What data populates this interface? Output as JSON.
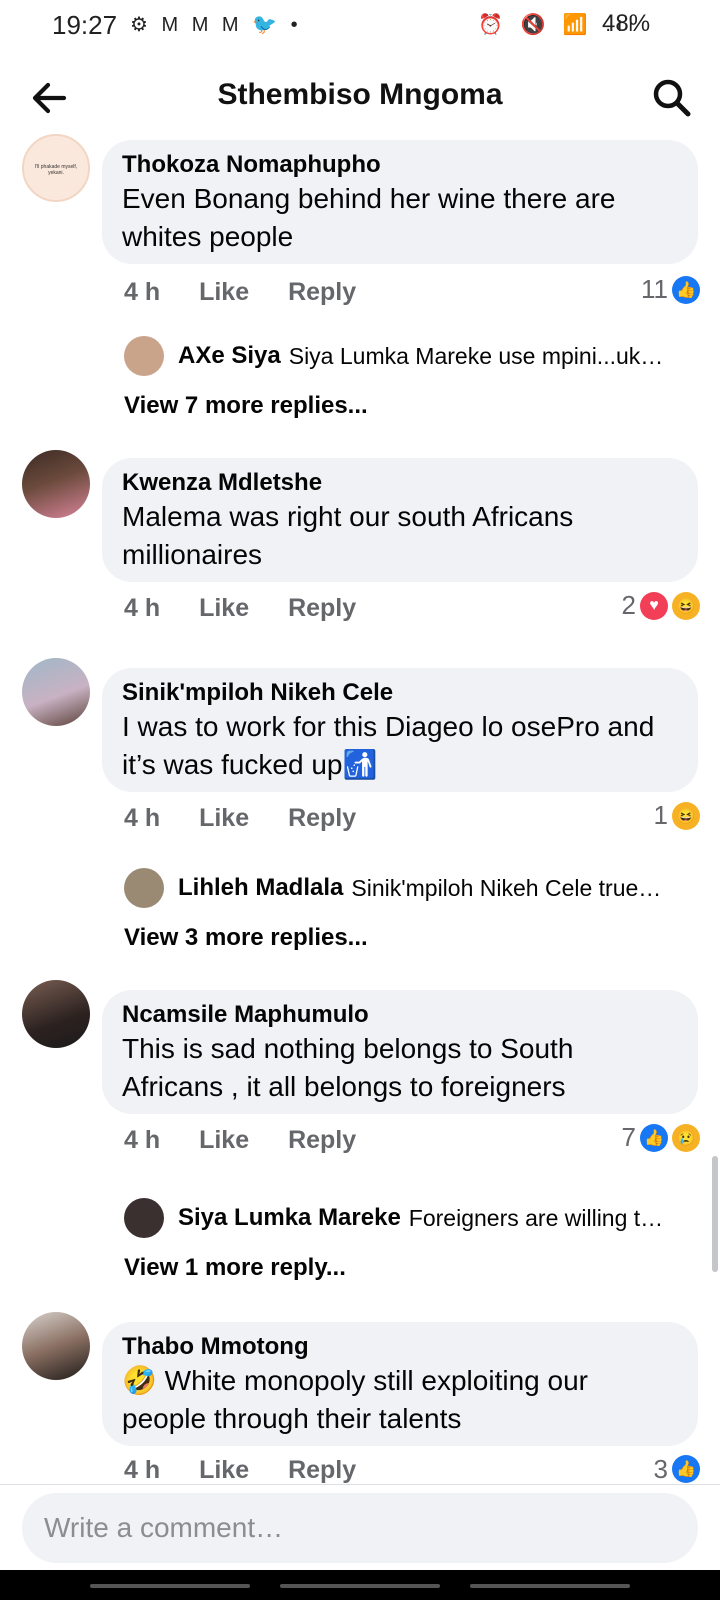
{
  "status_bar": {
    "time": "19:27",
    "left_icons": "⚙ M M M 🐦 •",
    "right_icons": "⏰ 🔇 📶 .ıl",
    "battery": "48%"
  },
  "header": {
    "title": "Sthembiso Mngoma",
    "back_icon": "arrow-left-icon",
    "search_icon": "search-icon"
  },
  "comments": [
    {
      "name": "Thokoza Nomaphupho",
      "text": "Even Bonang behind her wine there are whites people",
      "time": "4 h",
      "like": "Like",
      "reply": "Reply",
      "reaction_count": "11",
      "reactions": [
        "like"
      ],
      "avatar_text": "I'll phakade myself, yekani.",
      "reply_preview": {
        "name": "AXe Siya",
        "text": "Siya Lumka Mareke use mpini...uk…"
      },
      "view_more": "View 7 more replies..."
    },
    {
      "name": "Kwenza Mdletshe",
      "text": "Malema was right our south Africans millionaires",
      "time": "4 h",
      "like": "Like",
      "reply": "Reply",
      "reaction_count": "2",
      "reactions": [
        "love",
        "haha"
      ]
    },
    {
      "name": "Sinik'mpiloh Nikeh Cele",
      "text": "I was to work for this Diageo lo osePro and it’s was fucked up",
      "text_emoji": "🚮",
      "time": "4 h",
      "like": "Like",
      "reply": "Reply",
      "reaction_count": "1",
      "reactions": [
        "haha"
      ],
      "reply_preview": {
        "name": "Lihleh Madlala",
        "text": "Sinik'mpiloh Nikeh Cele true…"
      },
      "view_more": "View 3 more replies..."
    },
    {
      "name": "Ncamsile Maphumulo",
      "text": "This is sad nothing belongs to South Africans , it all belongs to foreigners",
      "time": "4 h",
      "like": "Like",
      "reply": "Reply",
      "reaction_count": "7",
      "reactions": [
        "like",
        "sad"
      ],
      "reply_preview": {
        "name": "Siya Lumka Mareke",
        "text": "Foreigners are willing t…"
      },
      "view_more": "View 1 more reply..."
    },
    {
      "name": "Thabo Mmotong",
      "text_emoji": "🤣",
      "text": " White monopoly still exploiting our people through their talents",
      "time": "4 h",
      "like": "Like",
      "reply": "Reply",
      "reaction_count": "3",
      "reactions": [
        "like"
      ]
    }
  ],
  "composer": {
    "placeholder": "Write a comment…"
  }
}
